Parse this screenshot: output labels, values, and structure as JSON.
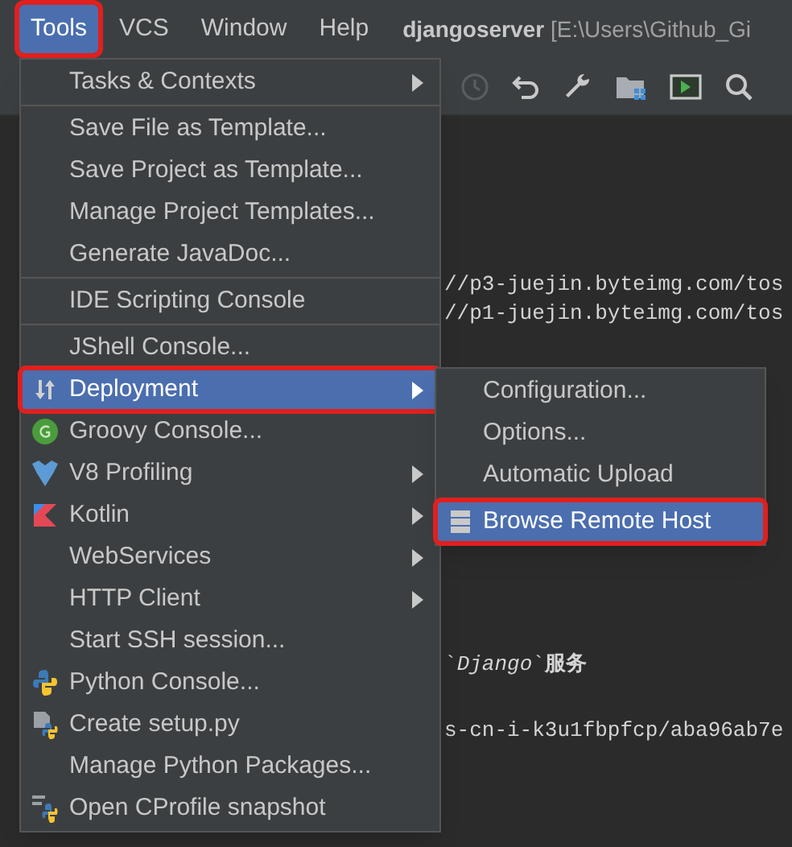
{
  "menu_bar": {
    "items": [
      {
        "label": "Tools",
        "selected": true,
        "highlighted": true
      },
      {
        "label": "VCS",
        "selected": false,
        "highlighted": false
      },
      {
        "label": "Window",
        "selected": false,
        "highlighted": false
      },
      {
        "label": "Help",
        "selected": false,
        "highlighted": false
      }
    ],
    "project": "djangoserver",
    "path": "[E:\\Users\\Github_Gi"
  },
  "editor": {
    "lines": [
      {
        "text": "//p3-juejin.byteimg.com/tos"
      },
      {
        "text": "//p1-juejin.byteimg.com/tos"
      },
      {
        "text": "`*Django*`**服务**"
      },
      {
        "text": "s-cn-i-k3u1fbpfcp/aba96ab7e"
      }
    ]
  },
  "tools_menu": {
    "items": [
      {
        "kind": "item",
        "label": "Tasks & Contexts",
        "selected": false,
        "submenu": true,
        "highlighted": false
      },
      {
        "kind": "separator"
      },
      {
        "kind": "item",
        "label": "Save File as Template...",
        "selected": false,
        "submenu": false,
        "highlighted": false
      },
      {
        "kind": "item",
        "label": "Save Project as Template...",
        "selected": false,
        "submenu": false,
        "highlighted": false
      },
      {
        "kind": "item",
        "label": "Manage Project Templates...",
        "selected": false,
        "submenu": false,
        "highlighted": false
      },
      {
        "kind": "item",
        "label": "Generate JavaDoc...",
        "selected": false,
        "submenu": false,
        "highlighted": false
      },
      {
        "kind": "separator"
      },
      {
        "kind": "item",
        "label": "IDE Scripting Console",
        "selected": false,
        "submenu": false,
        "highlighted": false
      },
      {
        "kind": "separator"
      },
      {
        "kind": "item",
        "label": "JShell Console...",
        "selected": false,
        "submenu": false,
        "highlighted": false
      },
      {
        "kind": "item",
        "label": "Deployment",
        "selected": true,
        "submenu": true,
        "highlighted": true
      },
      {
        "kind": "item",
        "label": "Groovy Console...",
        "selected": false,
        "submenu": false,
        "highlighted": false
      },
      {
        "kind": "item",
        "label": "V8 Profiling",
        "selected": false,
        "submenu": true,
        "highlighted": false
      },
      {
        "kind": "item",
        "label": "Kotlin",
        "selected": false,
        "submenu": true,
        "highlighted": false
      },
      {
        "kind": "item",
        "label": "WebServices",
        "selected": false,
        "submenu": true,
        "highlighted": false
      },
      {
        "kind": "item",
        "label": "HTTP Client",
        "selected": false,
        "submenu": true,
        "highlighted": false
      },
      {
        "kind": "item",
        "label": "Start SSH session...",
        "selected": false,
        "submenu": false,
        "highlighted": false
      },
      {
        "kind": "item",
        "label": "Python Console...",
        "selected": false,
        "submenu": false,
        "highlighted": false
      },
      {
        "kind": "item",
        "label": "Create setup.py",
        "selected": false,
        "submenu": false,
        "highlighted": false
      },
      {
        "kind": "item",
        "label": "Manage Python Packages...",
        "selected": false,
        "submenu": false,
        "highlighted": false
      },
      {
        "kind": "item",
        "label": "Open CProfile snapshot",
        "selected": false,
        "submenu": false,
        "highlighted": false
      }
    ]
  },
  "deployment_submenu": {
    "items": [
      {
        "label": "Configuration...",
        "selected": false,
        "highlighted": false
      },
      {
        "label": "Options...",
        "selected": false,
        "highlighted": false
      },
      {
        "label": "Automatic Upload",
        "selected": false,
        "highlighted": false
      },
      {
        "label": "Browse Remote Host",
        "selected": true,
        "highlighted": true
      }
    ]
  }
}
